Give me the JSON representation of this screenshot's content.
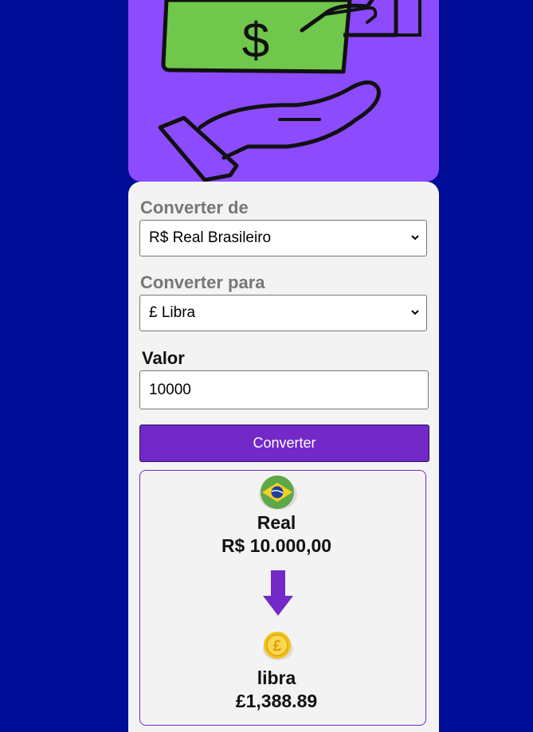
{
  "form": {
    "from_label": "Converter de",
    "from_selected": "R$ Real Brasileiro",
    "to_label": "Converter para",
    "to_selected": "£ Libra",
    "value_label": "Valor",
    "value_input": "10000",
    "convert_button": "Converter"
  },
  "result": {
    "from_currency_name": "Real",
    "from_amount": "R$ 10.000,00",
    "to_currency_name": "libra",
    "to_amount": "£1,388.89",
    "from_icon": "brazil-flag-icon",
    "to_icon": "pound-coin-icon",
    "arrow_icon": "arrow-down-icon"
  },
  "colors": {
    "page_background": "#000d96",
    "hero_background": "#8c4bff",
    "card_background": "#f3f3f3",
    "button": "#7328c8",
    "money_green": "#6cc24a"
  }
}
